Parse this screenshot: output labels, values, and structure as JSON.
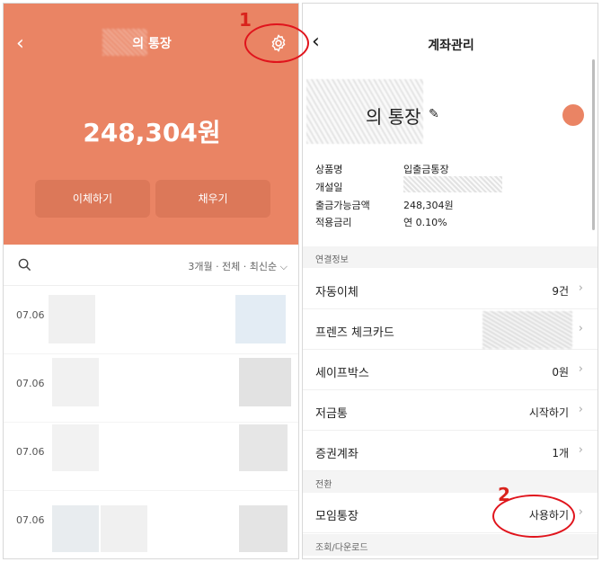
{
  "left_screen": {
    "header": {
      "title": "의 통장",
      "back_icon": "chevron-left-icon",
      "settings_icon": "gear-icon"
    },
    "balance": "248,304원",
    "buttons": {
      "transfer": "이체하기",
      "fill": "채우기"
    },
    "filter": {
      "text": "3개월 · 전체 · 최신순",
      "search_icon": "search-icon",
      "dropdown_icon": "chevron-down-icon"
    },
    "transactions": [
      {
        "date": "07.06"
      },
      {
        "date": "07.06"
      },
      {
        "date": "07.06"
      },
      {
        "date": "07.06"
      }
    ],
    "colors": {
      "accent": "#ea8464"
    }
  },
  "right_screen": {
    "header": {
      "title": "계좌관리",
      "back_icon": "chevron-left-icon"
    },
    "account_name": "의 통장",
    "info": {
      "product_label": "상품명",
      "product_value": "입출금통장",
      "opened_label": "개설일",
      "withdrawable_label": "출금가능금액",
      "withdrawable_value": "248,304원",
      "rate_label": "적용금리",
      "rate_value": "연 0.10%"
    },
    "sections": {
      "linked": "연결정보",
      "convert": "전환",
      "inquiry": "조회/다운로드"
    },
    "menu": {
      "auto_transfer": {
        "label": "자동이체",
        "value": "9건"
      },
      "check_card": {
        "label": "프렌즈 체크카드"
      },
      "safe_box": {
        "label": "세이프박스",
        "value": "0원"
      },
      "savings_box": {
        "label": "저금통",
        "value": "시작하기"
      },
      "securities": {
        "label": "증권계좌",
        "value": "1개"
      },
      "group_account": {
        "label": "모임통장",
        "value": "사용하기"
      }
    }
  },
  "annotations": {
    "step1": "1",
    "step2": "2",
    "color": "#e0141c"
  }
}
